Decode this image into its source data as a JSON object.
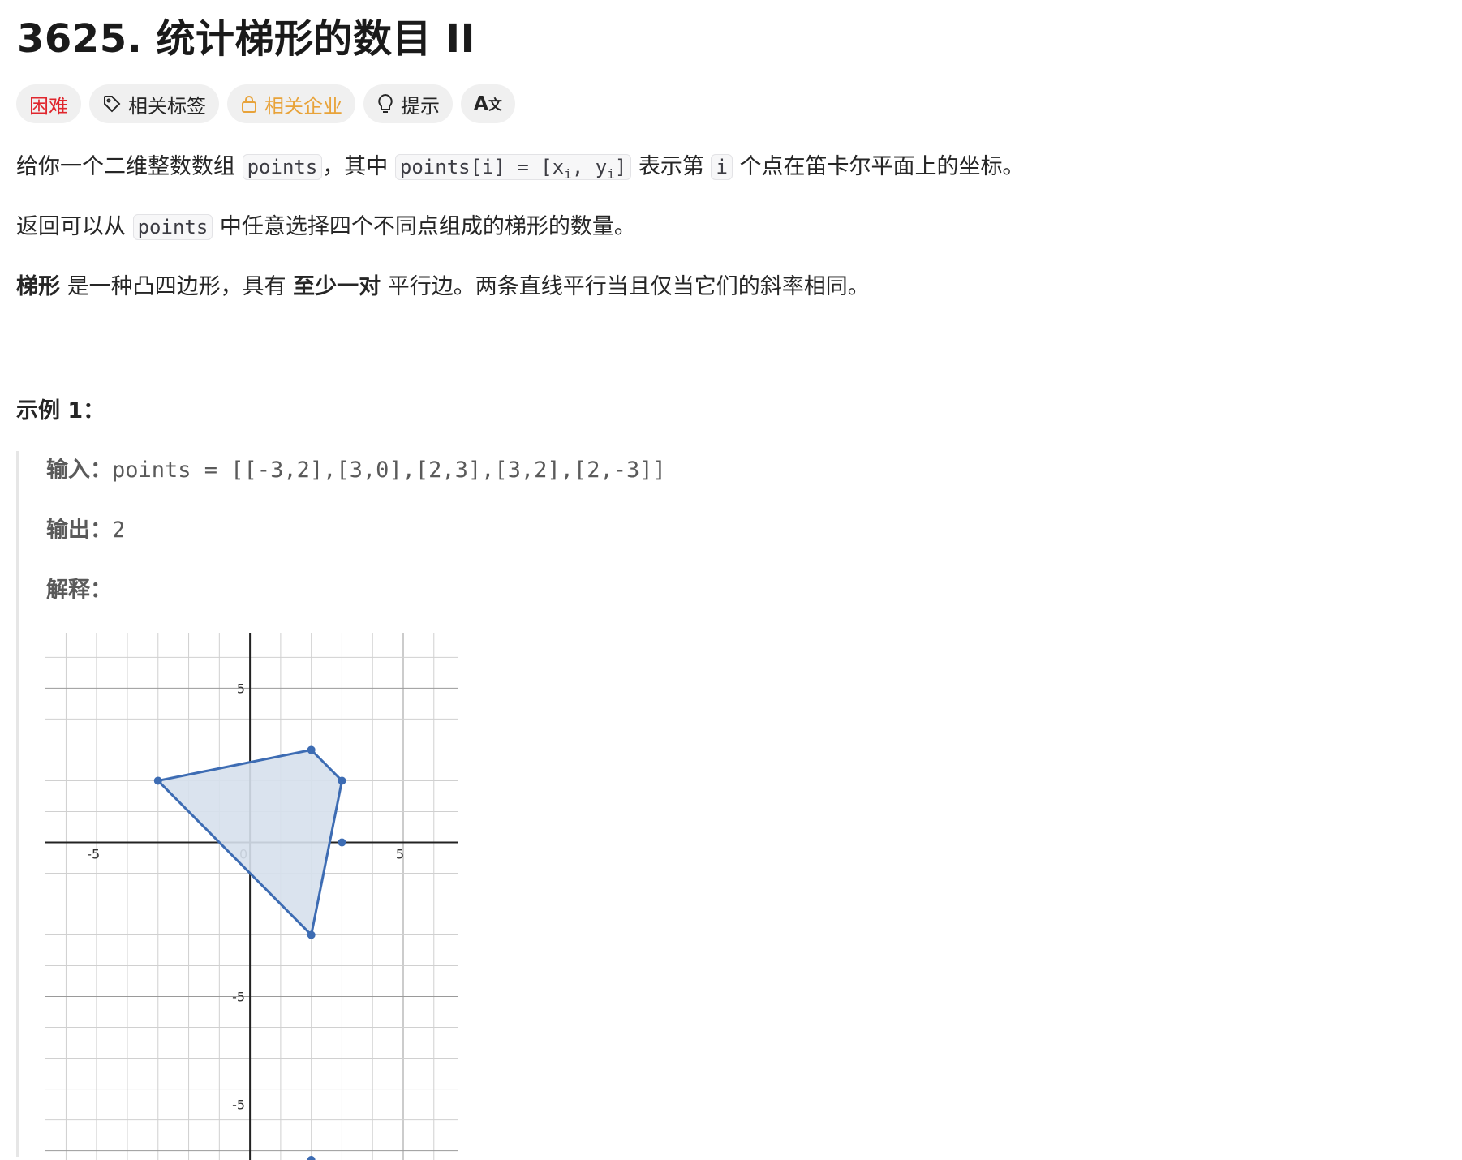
{
  "problem": {
    "title": "3625. 统计梯形的数目 II"
  },
  "tags": {
    "difficulty": "困难",
    "topics": "相关标签",
    "companies": "相关企业",
    "hint": "提示",
    "translate_icon": "translate-icon",
    "tag_icon": "tag-icon",
    "lock_icon": "lock-icon",
    "bulb_icon": "lightbulb-icon"
  },
  "description": {
    "p1_a": "给你一个二维整数数组 ",
    "p1_code1": "points",
    "p1_b": "，其中 ",
    "p1_code2_a": "points[i] = [x",
    "p1_code2_sub1": "i",
    "p1_code2_b": ", y",
    "p1_code2_sub2": "i",
    "p1_code2_c": "]",
    "p1_c": " 表示第 ",
    "p1_code3": "i",
    "p1_d": " 个点在笛卡尔平面上的坐标。",
    "p2_a": "返回可以从 ",
    "p2_code": "points",
    "p2_b": " 中任意选择四个不同点组成的梯形的数量。",
    "p3_bold1": "梯形",
    "p3_a": " 是一种凸四边形，具有 ",
    "p3_bold2": "至少一对",
    "p3_b": " 平行边。两条直线平行当且仅当它们的斜率相同。"
  },
  "example": {
    "title": "示例 1：",
    "input_label": "输入：",
    "input_value": "points = [[-3,2],[3,0],[2,3],[3,2],[2,-3]]",
    "output_label": "输出：",
    "output_value": "2",
    "explain_label": "解释："
  },
  "chart_data": {
    "type": "scatter",
    "title": "",
    "xlabel": "",
    "ylabel": "",
    "xlim": [
      -6.7,
      6.8
    ],
    "ylim": [
      -10.3,
      6.8
    ],
    "grid": true,
    "x_ticks": [
      -5,
      0,
      5
    ],
    "y_ticks": [
      5,
      -5,
      -5
    ],
    "y_tick_values": [
      5,
      -5,
      -8.5
    ],
    "points": [
      {
        "x": -3,
        "y": 2
      },
      {
        "x": 2,
        "y": 3
      },
      {
        "x": 3,
        "y": 2
      },
      {
        "x": 3,
        "y": 0
      },
      {
        "x": 2,
        "y": -3
      },
      {
        "x": 2,
        "y": -10.3
      }
    ],
    "polygon": [
      {
        "x": -3,
        "y": 2
      },
      {
        "x": 2,
        "y": 3
      },
      {
        "x": 3,
        "y": 2
      },
      {
        "x": 2,
        "y": -3
      }
    ],
    "colors": {
      "stroke": "#3d6cb3",
      "fill": "#d6e0ec",
      "grid": "#d0d0d0",
      "axis": "#222222"
    }
  }
}
